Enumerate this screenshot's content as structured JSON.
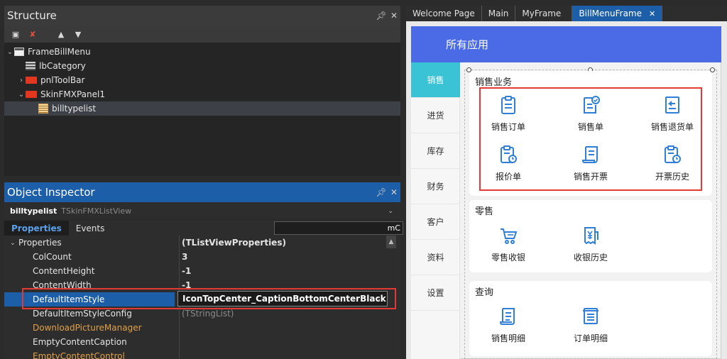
{
  "structure": {
    "title": "Structure",
    "tree": [
      {
        "label": "FrameBillMenu",
        "icon": "form-icon",
        "expanded": true
      },
      {
        "label": "lbCategory",
        "icon": "label-component-icon"
      },
      {
        "label": "pnlToolBar",
        "icon": "panel-component-icon",
        "expandable": true
      },
      {
        "label": "SkinFMXPanel1",
        "icon": "panel-component-icon",
        "expanded": true
      },
      {
        "label": "billtypelist",
        "icon": "listview-component-icon",
        "selected": true
      }
    ]
  },
  "inspector": {
    "title": "Object Inspector",
    "object_name": "billtypelist",
    "object_type": "TSkinFMXListView",
    "tabs": [
      "Properties",
      "Events"
    ],
    "search_value": "mC",
    "rows": [
      {
        "name": "Properties",
        "value": "(TListViewProperties)",
        "expanded": true
      },
      {
        "name": "ColCount",
        "value": "3"
      },
      {
        "name": "ContentHeight",
        "value": "-1"
      },
      {
        "name": "ContentWidth",
        "value": "-1"
      },
      {
        "name": "DefaultItemStyle",
        "value": "IconTopCenter_CaptionBottomCenterBlack",
        "selected": true
      },
      {
        "name": "DefaultItemStyleConfig",
        "value": "(TStringList)"
      },
      {
        "name": "DownloadPictureManager",
        "value": "",
        "style": "reference"
      },
      {
        "name": "EmptyContentCaption",
        "value": ""
      },
      {
        "name": "EmptyContentControl",
        "value": "",
        "style": "reference"
      }
    ],
    "edit_button_label": "..."
  },
  "editor_tabs": [
    {
      "label": "Welcome Page"
    },
    {
      "label": "Main"
    },
    {
      "label": "MyFrame"
    },
    {
      "label": "BillMenuFrame",
      "active": true
    }
  ],
  "app": {
    "header_title": "所有应用",
    "categories": [
      "销售",
      "进货",
      "库存",
      "财务",
      "客户",
      "资料",
      "设置"
    ],
    "active_category": "销售",
    "sections": [
      {
        "title": "销售业务",
        "items": [
          "销售订单",
          "销售单",
          "销售退货单",
          "报价单",
          "销售开票",
          "开票历史"
        ]
      },
      {
        "title": "零售",
        "items": [
          "零售收银",
          "收银历史"
        ]
      },
      {
        "title": "查询",
        "items": [
          "销售明细",
          "订单明细"
        ]
      }
    ]
  },
  "colors": {
    "accent_blue": "#1d5ea8",
    "app_header": "#4a6ae6",
    "active_category": "#3ac3d4",
    "icon_blue": "#2f7fd8",
    "highlight_red": "#e53935"
  }
}
